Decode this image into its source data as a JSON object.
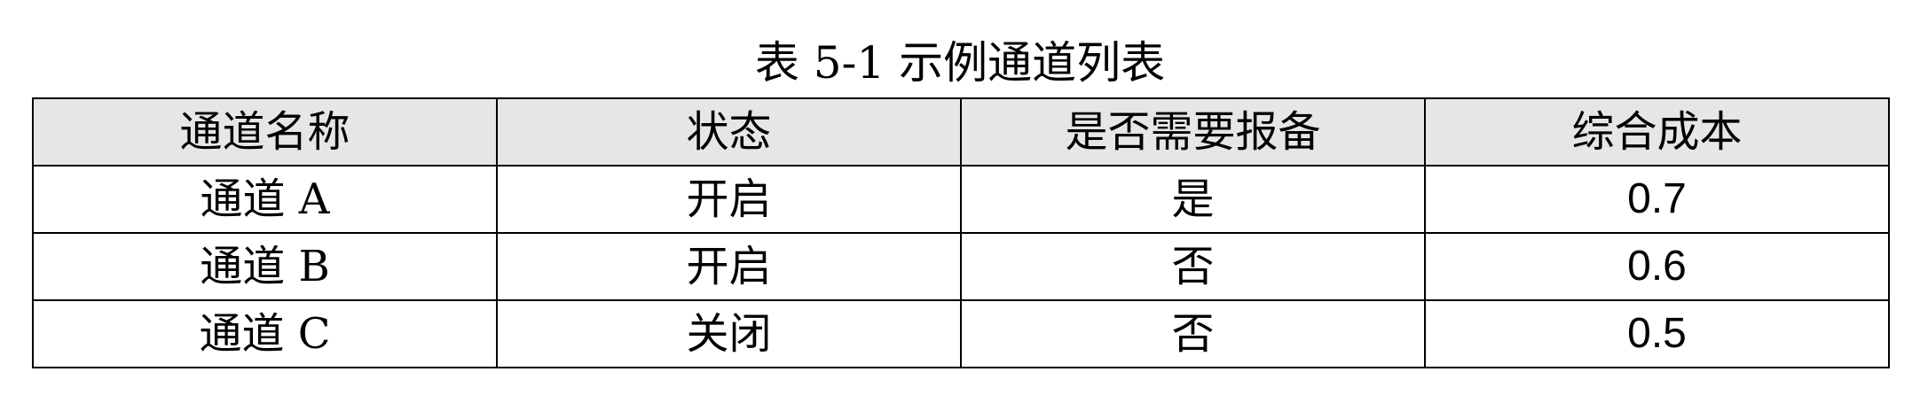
{
  "table": {
    "caption": "表 5-1 示例通道列表",
    "headers": [
      "通道名称",
      "状态",
      "是否需要报备",
      "综合成本"
    ],
    "rows": [
      [
        "通道 A",
        "开启",
        "是",
        "0.7"
      ],
      [
        "通道 B",
        "开启",
        "否",
        "0.6"
      ],
      [
        "通道 C",
        "关闭",
        "否",
        "0.5"
      ]
    ]
  }
}
